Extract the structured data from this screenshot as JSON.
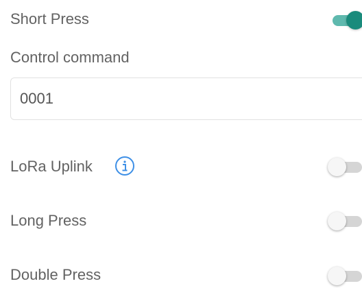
{
  "short_press": {
    "label": "Short Press",
    "enabled": true
  },
  "control_command": {
    "label": "Control command",
    "value": "0001"
  },
  "lora_uplink": {
    "label": "LoRa Uplink",
    "info_icon": "info-icon",
    "enabled": false
  },
  "long_press": {
    "label": "Long Press",
    "enabled": false
  },
  "double_press": {
    "label": "Double Press",
    "enabled": false
  },
  "colors": {
    "accent": "#1a8b7c",
    "accent_track": "#5fb9ae",
    "info": "#3d8fe6",
    "toggle_off_track": "#d5d5d5"
  }
}
